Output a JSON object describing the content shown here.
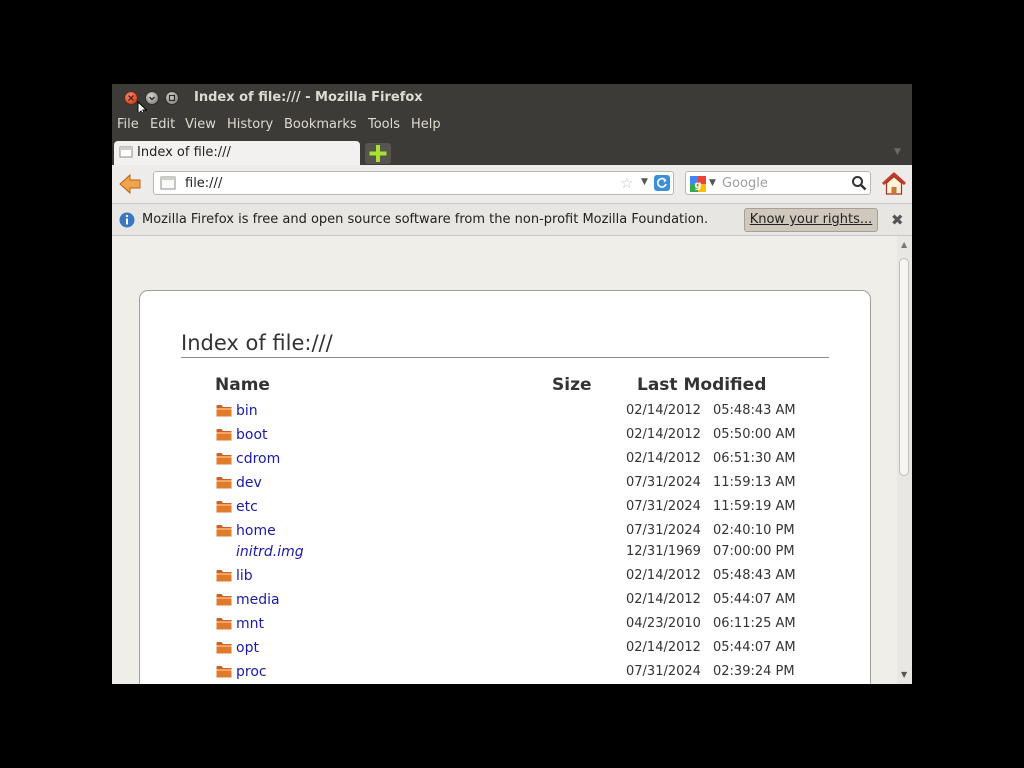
{
  "window": {
    "title": "Index of file:/// - Mozilla Firefox"
  },
  "menu": {
    "items": [
      {
        "label": "File"
      },
      {
        "label": "Edit"
      },
      {
        "label": "View"
      },
      {
        "label": "History"
      },
      {
        "label": "Bookmarks"
      },
      {
        "label": "Tools"
      },
      {
        "label": "Help"
      }
    ]
  },
  "tabs": [
    {
      "label": "Index of file:///"
    }
  ],
  "nav": {
    "url": "file:///",
    "search_placeholder": "Google"
  },
  "notification": {
    "text": "Mozilla Firefox is free and open source software from the non-profit Mozilla Foundation.",
    "button_label": "Know your rights..."
  },
  "page": {
    "heading": "Index of file:///",
    "columns": {
      "name": "Name",
      "size": "Size",
      "modified": "Last Modified"
    },
    "rows": [
      {
        "name": "bin",
        "type": "folder",
        "date": "02/14/2012",
        "time": "05:48:43 AM"
      },
      {
        "name": "boot",
        "type": "folder",
        "date": "02/14/2012",
        "time": "05:50:00 AM"
      },
      {
        "name": "cdrom",
        "type": "folder",
        "date": "02/14/2012",
        "time": "06:51:30 AM"
      },
      {
        "name": "dev",
        "type": "folder",
        "date": "07/31/2024",
        "time": "11:59:13 AM"
      },
      {
        "name": "etc",
        "type": "folder",
        "date": "07/31/2024",
        "time": "11:59:19 AM"
      },
      {
        "name": "home",
        "type": "folder",
        "date": "07/31/2024",
        "time": "02:40:10 PM"
      },
      {
        "name": "initrd.img",
        "type": "file",
        "date": "12/31/1969",
        "time": "07:00:00 PM"
      },
      {
        "name": "lib",
        "type": "folder",
        "date": "02/14/2012",
        "time": "05:48:43 AM"
      },
      {
        "name": "media",
        "type": "folder",
        "date": "02/14/2012",
        "time": "05:44:07 AM"
      },
      {
        "name": "mnt",
        "type": "folder",
        "date": "04/23/2010",
        "time": "06:11:25 AM"
      },
      {
        "name": "opt",
        "type": "folder",
        "date": "02/14/2012",
        "time": "05:44:07 AM"
      },
      {
        "name": "proc",
        "type": "folder",
        "date": "07/31/2024",
        "time": "02:39:24 PM"
      }
    ]
  },
  "colors": {
    "titlebar": "#3c3b37",
    "link": "#1a1aa6",
    "folder": "#e07a2c",
    "page_background": "#f0eee9"
  }
}
